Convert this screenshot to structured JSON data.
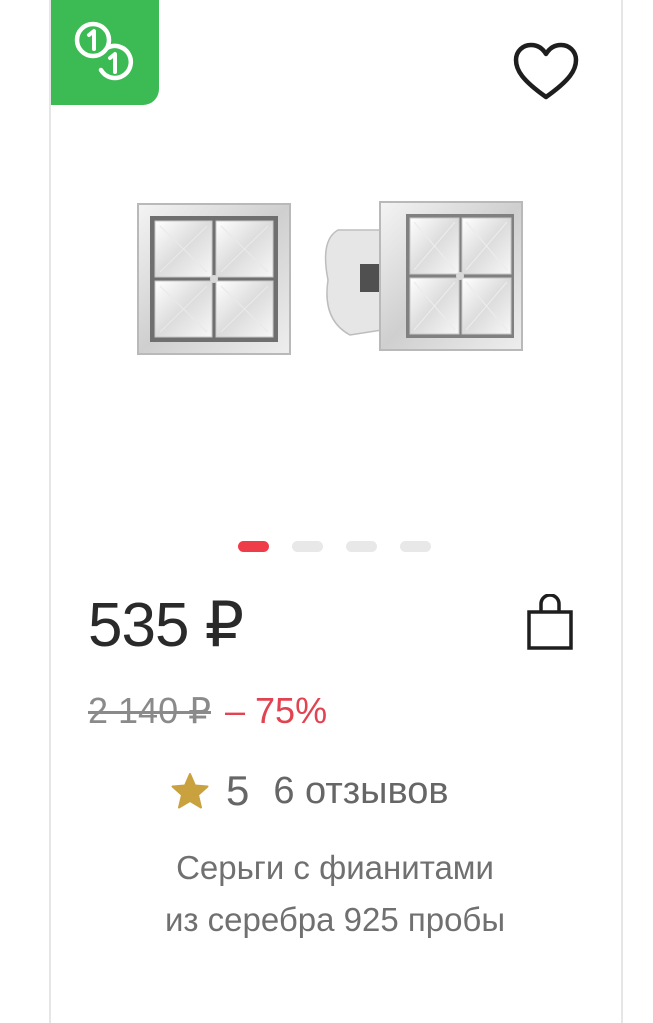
{
  "badge": {
    "icon": "installment-icon",
    "color": "#3cbb54"
  },
  "favorite": {
    "icon": "heart-icon"
  },
  "gallery": {
    "image": "earrings-photo",
    "slides": 4,
    "active_slide": 1
  },
  "product": {
    "price": "535 ₽",
    "old_price": "2 140 ₽",
    "discount": "– 75%",
    "rating": "5",
    "reviews": "6 отзывов",
    "title_line1": "Серьги с фианитами",
    "title_line2": "из серебра 925 пробы"
  },
  "colors": {
    "accent": "#ee3d48",
    "discount": "#e24350",
    "star": "#c9a13f"
  }
}
